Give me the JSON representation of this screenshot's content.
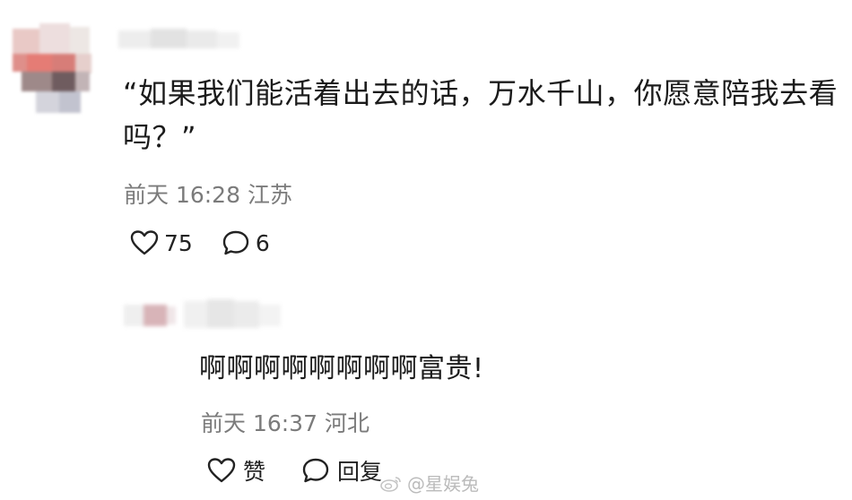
{
  "comment": {
    "text": "“如果我们能活着出去的话，万水千山，你愿意陪我去看吗？”",
    "time": "前天 16:28",
    "location": "江苏",
    "likes": "75",
    "replies": "6"
  },
  "reply": {
    "text": "啊啊啊啊啊啊啊啊富贵!",
    "time": "前天 16:37",
    "location": "河北",
    "like_label": "赞",
    "reply_label": "回复"
  },
  "watermark": {
    "text": "@星娱兔"
  },
  "colors": {
    "text": "#1b1b1b",
    "meta": "#7b7b7b",
    "watermark": "#bbbbbb"
  },
  "icons": {
    "like": "heart-outline-icon",
    "comment": "speech-bubble-icon",
    "weibo": "weibo-logo-icon"
  }
}
